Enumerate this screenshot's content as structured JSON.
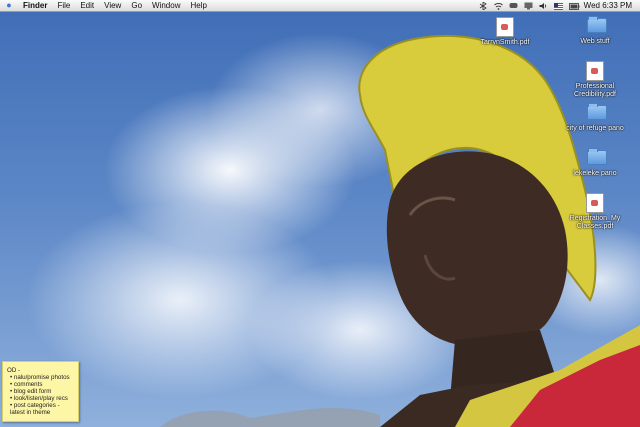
{
  "menubar": {
    "app": "Finder",
    "menus": [
      "File",
      "Edit",
      "View",
      "Go",
      "Window",
      "Help"
    ],
    "clock": "Wed 6:33 PM"
  },
  "desktop_icons": [
    {
      "label": "TarrynSmith.pdf",
      "kind": "pdf-document-icon"
    },
    {
      "label": "Web stuff",
      "kind": "folder-icon"
    },
    {
      "label": "Professional Credibility.pdf",
      "kind": "pdf-document-icon"
    },
    {
      "label": "city of refuge pano",
      "kind": "folder-icon"
    },
    {
      "label": "lekeleke pano",
      "kind": "folder-icon"
    },
    {
      "label": "Registration_My Classes.pdf",
      "kind": "pdf-document-icon"
    }
  ],
  "sticky_note": {
    "title": "OD -",
    "items": [
      "• nalu/promise photos",
      "• comments",
      "• blog edit form",
      "• look/listen/play recs",
      "• post categories - latest in theme"
    ]
  },
  "colors": {
    "sky": "#4a73b3",
    "helmet": "#d6c83a",
    "statue": "#3a2a22",
    "cape_red": "#c8283a",
    "sticky": "#fdf6a6"
  }
}
